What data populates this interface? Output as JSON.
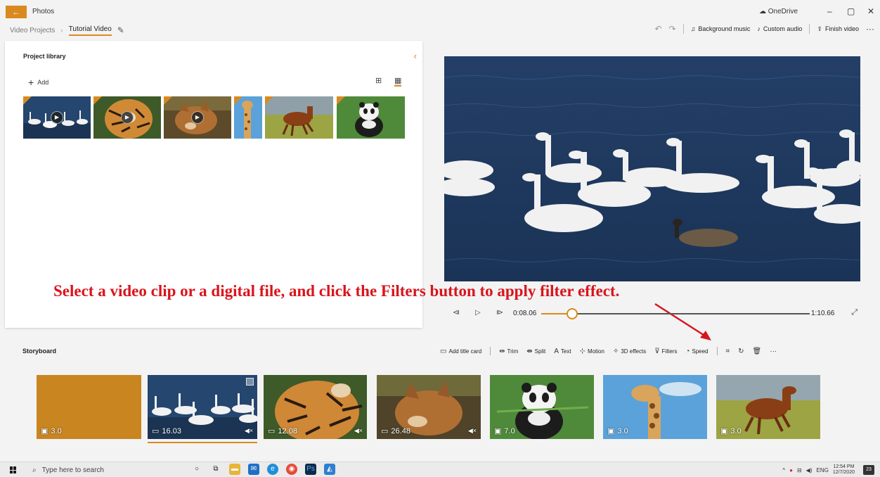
{
  "app": {
    "title": "Photos",
    "onedrive_label": "OneDrive",
    "window_controls": [
      "–",
      "▢",
      "✕"
    ]
  },
  "breadcrumb": {
    "parent": "Video Projects",
    "current": "Tutorial Video"
  },
  "toolbar": {
    "background_music": "Background music",
    "custom_audio": "Custom audio",
    "finish_video": "Finish video",
    "more": "···"
  },
  "library": {
    "title": "Project library",
    "add_label": "Add",
    "thumbnails": [
      {
        "subject": "swans",
        "has_play": true
      },
      {
        "subject": "tiger",
        "has_play": true
      },
      {
        "subject": "wolf",
        "has_play": true
      },
      {
        "subject": "giraffe",
        "has_play": false
      },
      {
        "subject": "horse",
        "has_play": false
      },
      {
        "subject": "panda",
        "has_play": false
      }
    ]
  },
  "instruction": "Select a video clip or a digital file, and click the Filters button to apply filter effect.",
  "playback": {
    "current_time": "0:08.06",
    "total_time": "1:10.66",
    "progress": 0.114
  },
  "storyboard": {
    "title": "Storyboard",
    "tools": {
      "add_title_card": "Add title card",
      "trim": "Trim",
      "split": "Split",
      "text": "Text",
      "motion": "Motion",
      "effects_3d": "3D effects",
      "filters": "Filters",
      "speed": "Speed",
      "more": "···"
    },
    "clips": [
      {
        "duration": "3.0",
        "kind": "title-card",
        "muted": false
      },
      {
        "duration": "16.03",
        "kind": "video",
        "subject": "swans",
        "muted": true,
        "selected": true
      },
      {
        "duration": "12.08",
        "kind": "video",
        "subject": "tiger",
        "muted": true
      },
      {
        "duration": "26.48",
        "kind": "video",
        "subject": "wolf",
        "muted": true
      },
      {
        "duration": "7.0",
        "kind": "image",
        "subject": "panda",
        "muted": false
      },
      {
        "duration": "3.0",
        "kind": "image",
        "subject": "giraffe",
        "muted": false
      },
      {
        "duration": "3.0",
        "kind": "image",
        "subject": "horse",
        "muted": false
      }
    ]
  },
  "taskbar": {
    "search_placeholder": "Type here to search",
    "language": "ENG",
    "time": "12:54 PM",
    "date": "12/7/2020",
    "notification_count": "23"
  },
  "colors": {
    "accent": "#d98a1f",
    "annotation_red": "#d9141c"
  }
}
